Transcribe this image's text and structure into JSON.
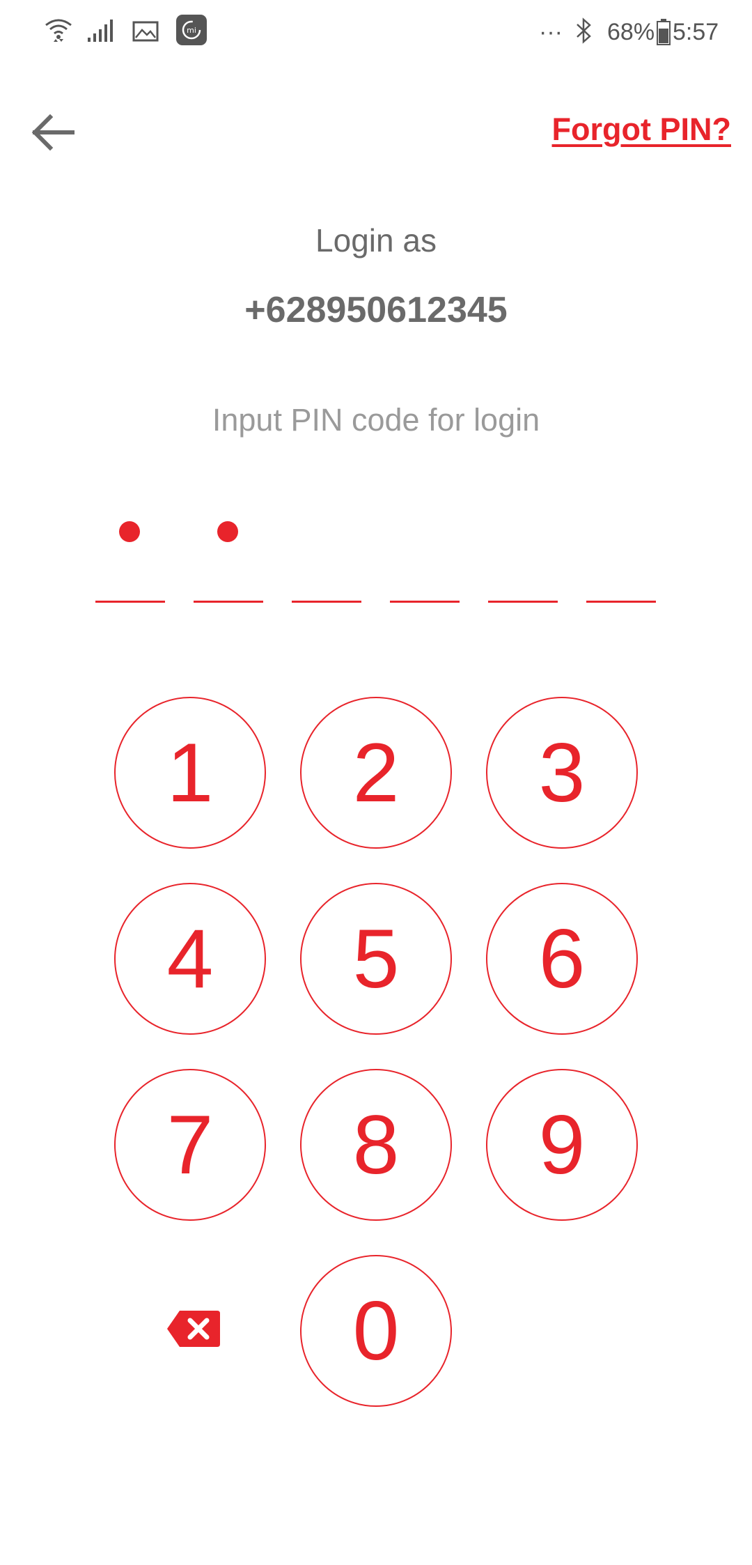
{
  "status_bar": {
    "battery": "68%",
    "time": "5:57",
    "overflow": "···"
  },
  "header": {
    "back_icon": "arrow-left-icon",
    "forgot_label": "Forgot PIN?"
  },
  "login": {
    "login_as_label": "Login as",
    "phone": "+628950612345",
    "instruction": "Input PIN code for login"
  },
  "pin": {
    "length": 6,
    "entered": 2
  },
  "keypad": {
    "keys": [
      "1",
      "2",
      "3",
      "4",
      "5",
      "6",
      "7",
      "8",
      "9",
      "0"
    ],
    "backspace_icon": "backspace-icon"
  },
  "colors": {
    "accent": "#e8242b",
    "text_dark": "#6a6a6a",
    "text_light": "#9a9a9a"
  }
}
